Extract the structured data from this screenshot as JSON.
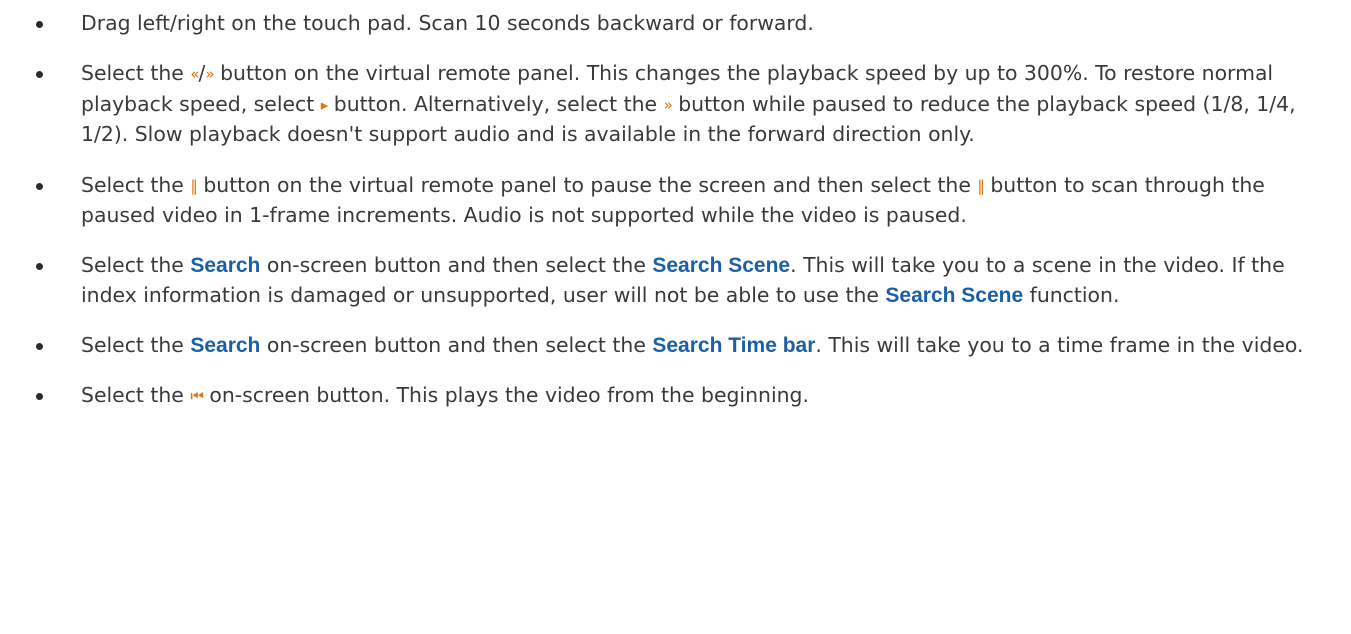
{
  "bullets": [
    {
      "parts": [
        {
          "type": "text",
          "value": "Drag left/right on the touch pad. Scan 10 seconds backward or forward."
        }
      ]
    },
    {
      "parts": [
        {
          "type": "text",
          "value": "Select the "
        },
        {
          "type": "icon",
          "name": "rewind-icon",
          "glyph": "«"
        },
        {
          "type": "text",
          "value": "/"
        },
        {
          "type": "icon",
          "name": "fast-forward-icon",
          "glyph": "»"
        },
        {
          "type": "text",
          "value": " button on the virtual remote panel. This changes the playback speed by up to 300%. To restore normal playback speed, select "
        },
        {
          "type": "icon",
          "name": "play-icon",
          "glyph": "▸"
        },
        {
          "type": "text",
          "value": " button. Alternatively, select the "
        },
        {
          "type": "icon",
          "name": "fast-forward-icon",
          "glyph": "»"
        },
        {
          "type": "text",
          "value": " button while paused to reduce the playback speed (1/8, 1/4, 1/2). Slow playback doesn't support audio and is available in the forward direction only."
        }
      ]
    },
    {
      "parts": [
        {
          "type": "text",
          "value": "Select the "
        },
        {
          "type": "icon",
          "name": "pause-icon",
          "glyph": "‖"
        },
        {
          "type": "text",
          "value": " button on the virtual remote panel to pause the screen and then select the "
        },
        {
          "type": "icon",
          "name": "pause-icon",
          "glyph": "‖"
        },
        {
          "type": "text",
          "value": " button to scan through the paused video in 1-frame increments. Audio is not supported while the video is paused."
        }
      ]
    },
    {
      "parts": [
        {
          "type": "text",
          "value": "Select the "
        },
        {
          "type": "kw",
          "value": "Search"
        },
        {
          "type": "text",
          "value": " on-screen button and then select the "
        },
        {
          "type": "kw",
          "value": "Search Scene"
        },
        {
          "type": "text",
          "value": ". This will take you to a scene in the video. If the index information is damaged or unsupported, user will not be able to use the "
        },
        {
          "type": "kw",
          "value": "Search Scene"
        },
        {
          "type": "text",
          "value": " function."
        }
      ]
    },
    {
      "parts": [
        {
          "type": "text",
          "value": "Select the "
        },
        {
          "type": "kw",
          "value": "Search"
        },
        {
          "type": "text",
          "value": " on-screen button and then select the "
        },
        {
          "type": "kw",
          "value": "Search Time bar"
        },
        {
          "type": "text",
          "value": ". This will take you to a time frame in the video."
        }
      ]
    },
    {
      "parts": [
        {
          "type": "text",
          "value": "Select the "
        },
        {
          "type": "icon",
          "name": "skip-to-start-icon",
          "glyph": "⏮"
        },
        {
          "type": "text",
          "value": " on-screen button. This plays the video from the beginning."
        }
      ]
    }
  ],
  "colors": {
    "body_text": "#3a3a3a",
    "keyword": "#1b5fa8",
    "icon": "#e07810"
  }
}
